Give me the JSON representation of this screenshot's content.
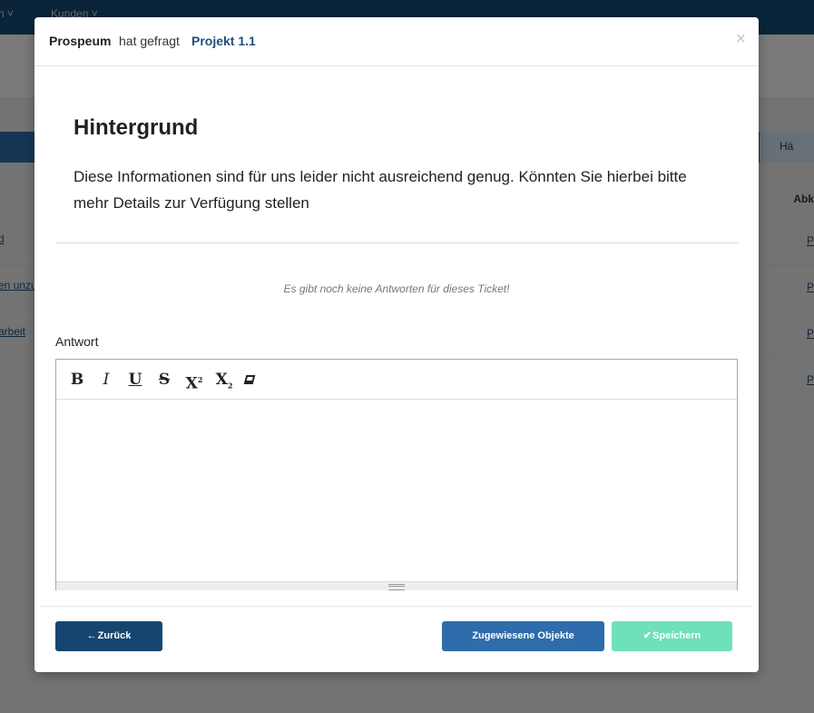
{
  "background": {
    "nav_items": [
      "n ˅",
      "Kunden ˅"
    ],
    "right_header_cell": "Hä",
    "column_header": "Abk",
    "rows": [
      {
        "link": "d",
        "right": "P"
      },
      {
        "link": "en unzu",
        "right": "P"
      },
      {
        "link": "arbeit",
        "right": "P"
      },
      {
        "link": "",
        "right": "P"
      }
    ]
  },
  "modal": {
    "header": {
      "author": "Prospeum",
      "verb": "hat gefragt",
      "project": "Projekt 1.1",
      "close_icon": "×"
    },
    "question": {
      "title": "Hintergrund",
      "text": "Diese Informationen sind für uns leider nicht ausreichend genug. Könnten Sie hierbei bitte mehr Details zur Verfügung stellen"
    },
    "no_answers_text": "Es gibt noch keine Antworten für dieses Ticket!",
    "answer_label": "Antwort",
    "editor": {
      "toolbar": [
        "bold-icon",
        "italic-icon",
        "underline-icon",
        "strikethrough-icon",
        "superscript-icon",
        "subscript-icon",
        "remove-format-icon"
      ],
      "value": ""
    },
    "buttons": {
      "back_icon": "←",
      "back": "Zurück",
      "assigned_objects": "Zugewiesene Objekte",
      "save_icon": "✔",
      "save": "Speichern"
    },
    "colors": {
      "primary_dark": "#16466f",
      "primary": "#2e6cab",
      "success": "#6ee0bb",
      "project_link": "#1f4f7a"
    }
  }
}
